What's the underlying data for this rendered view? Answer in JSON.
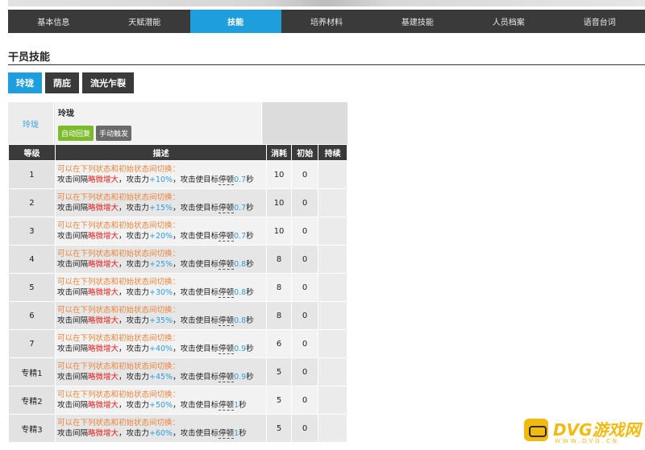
{
  "nav_tabs": [
    {
      "label": "基本信息",
      "active": false
    },
    {
      "label": "天赋潜能",
      "active": false
    },
    {
      "label": "技能",
      "active": true
    },
    {
      "label": "培养材料",
      "active": false
    },
    {
      "label": "基建技能",
      "active": false
    },
    {
      "label": "人员档案",
      "active": false
    },
    {
      "label": "语音台词",
      "active": false
    }
  ],
  "section_title": "干员技能",
  "skill_tabs": [
    {
      "label": "玲珑",
      "active": true
    },
    {
      "label": "荫庇",
      "active": false
    },
    {
      "label": "流光乍裂",
      "active": false
    }
  ],
  "skill_info": {
    "name_cell": "玲珑",
    "name": "玲珑",
    "tag_recovery": "自动回复",
    "tag_trigger": "手动触发"
  },
  "table": {
    "headers": [
      "等级",
      "描述",
      "消耗",
      "初始",
      "持续"
    ],
    "rows": [
      {
        "level": "1",
        "line1": "可以在下列状态和初始状态间切换：",
        "a": "攻击间隔",
        "b": "略微增大",
        "c": "，攻击力",
        "d": "+10%",
        "e": "，攻击使目标",
        "f": "停顿",
        "g": "0.7",
        "h": "秒",
        "cost": "10",
        "init": "0",
        "dur": ""
      },
      {
        "level": "2",
        "line1": "可以在下列状态和初始状态间切换：",
        "a": "攻击间隔",
        "b": "略微增大",
        "c": "，攻击力",
        "d": "+15%",
        "e": "，攻击使目标",
        "f": "停顿",
        "g": "0.7",
        "h": "秒",
        "cost": "10",
        "init": "0",
        "dur": ""
      },
      {
        "level": "3",
        "line1": "可以在下列状态和初始状态间切换：",
        "a": "攻击间隔",
        "b": "略微增大",
        "c": "，攻击力",
        "d": "+20%",
        "e": "，攻击使目标",
        "f": "停顿",
        "g": "0.7",
        "h": "秒",
        "cost": "10",
        "init": "0",
        "dur": ""
      },
      {
        "level": "4",
        "line1": "可以在下列状态和初始状态间切换：",
        "a": "攻击间隔",
        "b": "略微增大",
        "c": "，攻击力",
        "d": "+25%",
        "e": "，攻击使目标",
        "f": "停顿",
        "g": "0.8",
        "h": "秒",
        "cost": "8",
        "init": "0",
        "dur": ""
      },
      {
        "level": "5",
        "line1": "可以在下列状态和初始状态间切换：",
        "a": "攻击间隔",
        "b": "略微增大",
        "c": "，攻击力",
        "d": "+30%",
        "e": "，攻击使目标",
        "f": "停顿",
        "g": "0.8",
        "h": "秒",
        "cost": "8",
        "init": "0",
        "dur": ""
      },
      {
        "level": "6",
        "line1": "可以在下列状态和初始状态间切换：",
        "a": "攻击间隔",
        "b": "略微增大",
        "c": "，攻击力",
        "d": "+35%",
        "e": "，攻击使目标",
        "f": "停顿",
        "g": "0.8",
        "h": "秒",
        "cost": "8",
        "init": "0",
        "dur": ""
      },
      {
        "level": "7",
        "line1": "可以在下列状态和初始状态间切换：",
        "a": "攻击间隔",
        "b": "略微增大",
        "c": "，攻击力",
        "d": "+40%",
        "e": "，攻击使目标",
        "f": "停顿",
        "g": "0.9",
        "h": "秒",
        "cost": "6",
        "init": "0",
        "dur": ""
      },
      {
        "level": "专精1",
        "line1": "可以在下列状态和初始状态间切换：",
        "a": "攻击间隔",
        "b": "略微增大",
        "c": "，攻击力",
        "d": "+45%",
        "e": "，攻击使目标",
        "f": "停顿",
        "g": "0.9",
        "h": "秒",
        "cost": "5",
        "init": "0",
        "dur": ""
      },
      {
        "level": "专精2",
        "line1": "可以在下列状态和初始状态间切换：",
        "a": "攻击间隔",
        "b": "略微增大",
        "c": "，攻击力",
        "d": "+50%",
        "e": "，攻击使目标",
        "f": "停顿",
        "g": "1",
        "h": "秒",
        "cost": "5",
        "init": "0",
        "dur": ""
      },
      {
        "level": "专精3",
        "line1": "可以在下列状态和初始状态间切换：",
        "a": "攻击间隔",
        "b": "略微增大",
        "c": "，攻击力",
        "d": "+60%",
        "e": "，攻击使目标",
        "f": "停顿",
        "g": "1",
        "h": "秒",
        "cost": "5",
        "init": "0",
        "dur": ""
      }
    ]
  },
  "watermark": {
    "title": "DVG游戏网",
    "sub": "WWW.DVG.CN"
  },
  "colors": {
    "accent": "#1f9ede",
    "dark": "#3a3a3a",
    "orange": "#e8843a",
    "red": "#e0201b",
    "blue": "#2c9ee0",
    "green_tag": "#7dbb2c"
  }
}
